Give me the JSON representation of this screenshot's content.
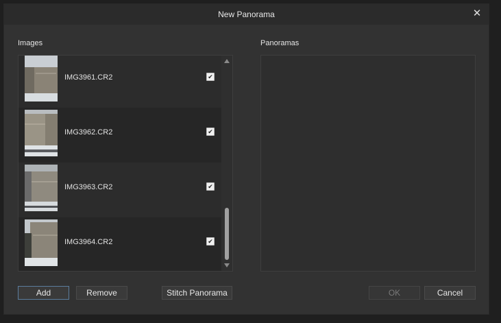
{
  "dialog": {
    "title": "New Panorama",
    "close_icon": "close-icon"
  },
  "images": {
    "label": "Images",
    "items": [
      {
        "filename": "IMG3961.CR2",
        "checked": true
      },
      {
        "filename": "IMG3962.CR2",
        "checked": true
      },
      {
        "filename": "IMG3963.CR2",
        "checked": true
      },
      {
        "filename": "IMG3964.CR2",
        "checked": true
      }
    ]
  },
  "panoramas": {
    "label": "Panoramas"
  },
  "buttons": {
    "add": "Add",
    "remove": "Remove",
    "stitch": "Stitch Panorama",
    "ok": "OK",
    "cancel": "Cancel"
  },
  "checkmark": "✔"
}
